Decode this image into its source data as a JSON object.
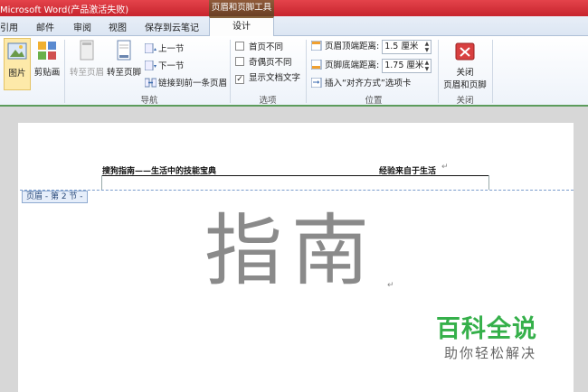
{
  "window": {
    "title": "Microsoft Word(产品激活失败)",
    "context_title": "页眉和页脚工具"
  },
  "tabs": [
    {
      "label": "引用"
    },
    {
      "label": "邮件"
    },
    {
      "label": "审阅"
    },
    {
      "label": "视图"
    },
    {
      "label": "保存到云笔记"
    },
    {
      "label": "设计"
    }
  ],
  "ribbon": {
    "insert": {
      "picture": "图片",
      "clipart": "剪贴画"
    },
    "navigation": {
      "goto_header": "转至页眉",
      "goto_footer": "转至页脚",
      "prev": "上一节",
      "next": "下一节",
      "link_previous": "链接到前一条页眉",
      "label": "导航"
    },
    "options": {
      "first_page": "首页不同",
      "odd_even": "奇偶页不同",
      "show_text": "显示文档文字",
      "label": "选项"
    },
    "position": {
      "header_dist_label": "页眉顶端距离:",
      "header_dist_value": "1.5 厘米",
      "footer_dist_label": "页脚底端距离:",
      "footer_dist_value": "1.75 厘米",
      "insert_align": "插入“对齐方式”选项卡",
      "label": "位置"
    },
    "close": {
      "button": "关闭\n页眉和页脚",
      "line1": "关闭",
      "line2": "页眉和页脚",
      "label": "关闭"
    }
  },
  "document": {
    "header_left": "搜狗指南——生活中的技能宝典",
    "header_right": "经验来自于生活",
    "header_tag": "页眉 - 第 2 节 -",
    "body_text": "指南",
    "para_mark": "↵"
  },
  "watermark": {
    "title": "百科全说",
    "subtitle": "助你轻松解决"
  },
  "colors": {
    "title_bar": "#d0303a",
    "context_tab": "#7a4a2c",
    "watermark_green": "#35b04a",
    "ribbon_border": "#5c9c5c"
  }
}
